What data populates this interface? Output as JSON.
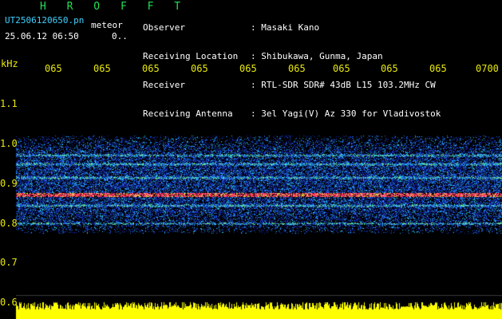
{
  "header": {
    "program": "H R O F F T",
    "filename": "UT2506120650.pn",
    "filename_suffix": "meteor",
    "datetime": "25.06.12 06:50",
    "extra": "0.."
  },
  "info": {
    "rows": [
      {
        "label": "Observer",
        "value": ": Masaki Kano"
      },
      {
        "label": "Receiving Location",
        "value": ": Shibukawa, Gunma, Japan"
      },
      {
        "label": "Receiver",
        "value": ": RTL-SDR SDR# 43dB L15 103.2MHz CW"
      },
      {
        "label": "Receiving Antenna",
        "value": ": 3el Yagi(V) Az 330 for Vladivostok"
      }
    ]
  },
  "axes": {
    "y_unit": "kHz",
    "y_ticks": [
      "1.1",
      "1.0",
      "0.9",
      "0.8",
      "0.7",
      "0.6"
    ],
    "x_ticks": [
      "065",
      "065",
      "065",
      "065",
      "065",
      "065",
      "065",
      "065",
      "065",
      "0700"
    ]
  },
  "colors": {
    "background": "#000000",
    "label_text": "#ffffff",
    "title_text": "#22e055",
    "filename_text": "#3fd0ff",
    "axis_text": "#e8e80e",
    "echo_band": "#ff2060",
    "signal_power": "#ffff00"
  },
  "spectrogram": {
    "signal_band_khz": [
      0.775,
      1.02
    ],
    "echo_line_khz": 0.872,
    "secondary_lines_khz": [
      0.971,
      0.949,
      0.915,
      0.845,
      0.8
    ]
  }
}
